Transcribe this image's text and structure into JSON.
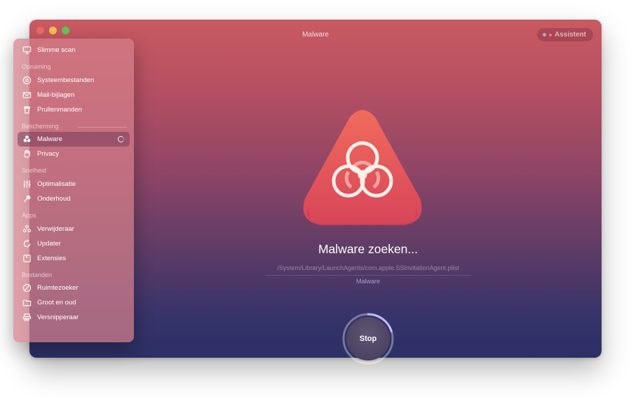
{
  "window": {
    "title": "Malware",
    "assistant_label": "Assistent"
  },
  "sidebar": {
    "top_item": {
      "label": "Slimme scan",
      "icon": "smart-scan-icon"
    },
    "sections": [
      {
        "title": "Opruiming",
        "items": [
          {
            "label": "Systeembestanden",
            "icon": "system-junk-icon"
          },
          {
            "label": "Mail-bijlagen",
            "icon": "mail-icon"
          },
          {
            "label": "Prullenmanden",
            "icon": "trash-icon"
          }
        ]
      },
      {
        "title": "Bescherming",
        "items": [
          {
            "label": "Malware",
            "icon": "biohazard-icon",
            "selected": true,
            "scanning": true
          },
          {
            "label": "Privacy",
            "icon": "hand-icon"
          }
        ]
      },
      {
        "title": "Snelheid",
        "items": [
          {
            "label": "Optimalisatie",
            "icon": "sliders-icon"
          },
          {
            "label": "Onderhoud",
            "icon": "wrench-icon"
          }
        ]
      },
      {
        "title": "Apps",
        "items": [
          {
            "label": "Verwijderaar",
            "icon": "uninstaller-icon"
          },
          {
            "label": "Updater",
            "icon": "updater-icon"
          },
          {
            "label": "Extensies",
            "icon": "extensions-icon"
          }
        ]
      },
      {
        "title": "Bestanden",
        "items": [
          {
            "label": "Ruimtezoeker",
            "icon": "space-lens-icon"
          },
          {
            "label": "Groot en oud",
            "icon": "folder-icon"
          },
          {
            "label": "Versnipperaar",
            "icon": "shredder-icon"
          }
        ]
      }
    ]
  },
  "main": {
    "heading": "Malware zoeken...",
    "scan_path": "/System/Library/LaunchAgents/com.apple.SSInvitationAgent.plist",
    "module_label": "Malware",
    "stop_label": "Stop",
    "scan_progress": 0.2
  },
  "colors": {
    "accent": "#e0575d",
    "window_top": "#c95a61",
    "window_bottom": "#2c2f66"
  }
}
